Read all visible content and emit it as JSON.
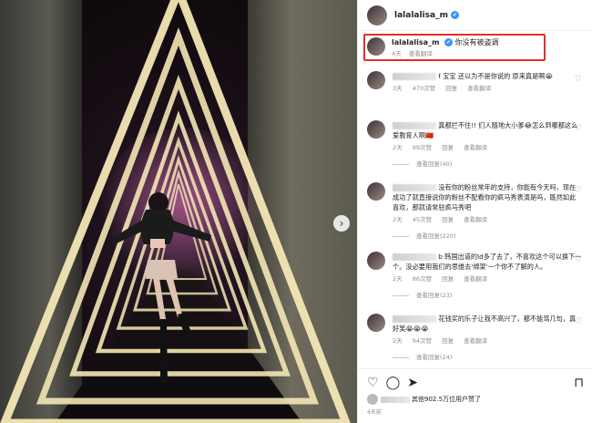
{
  "post": {
    "username": "lalalalisa_m",
    "caption": "你没有被盗调",
    "caption_age": "4天",
    "caption_translate": "查看翻译"
  },
  "comments": [
    {
      "text": "f 宝宝 还以为不是你说的 原来真是啊😭",
      "age": "3天",
      "likes": "470次赞",
      "reply": "回复",
      "translate": "查看翻译",
      "more_replies": ""
    },
    {
      "text": "真都拦不住!! 们人随地大小爹😂怎么到哪都这么爱教育人啊🇨🇳",
      "age": "2天",
      "likes": "99次赞",
      "reply": "回复",
      "translate": "查看翻译",
      "more_replies": "查看回复(40)"
    },
    {
      "text": "没有你的粉丝常年的支持，你能有今天吗，现在成功了就直接说你的粉丝不配看你的疯马秀表演是吗，既然如此喜欢，那就请常驻疯马秀吧",
      "age": "2天",
      "likes": "45次赞",
      "reply": "回复",
      "translate": "查看翻译",
      "more_replies": "查看回复(220)"
    },
    {
      "text": "b 韩国出道的ld多了去了，不喜欢这个可以换下一个。没必要用我们的思维去'绑架'一个你不了解的人。",
      "age": "2天",
      "likes": "86次赞",
      "reply": "回复",
      "translate": "查看翻译",
      "more_replies": "查看回复(23)"
    },
    {
      "text": "花钱买的乐子让我不高兴了，都不能骂几句，真好笑😭😭😭",
      "age": "2天",
      "likes": "94次赞",
      "reply": "回复",
      "translate": "查看翻译",
      "more_replies": "查看回复(24)"
    }
  ],
  "footer": {
    "likes_text": "其他902.5万位用户赞了",
    "post_age": "4天前"
  },
  "icons": {
    "verified": "✔",
    "heart": "♡",
    "comment": "◯",
    "share": "➤",
    "save": "⊓",
    "next": "›"
  },
  "colors": {
    "highlight_border": "#e0302a",
    "verified_badge": "#3897f0"
  }
}
